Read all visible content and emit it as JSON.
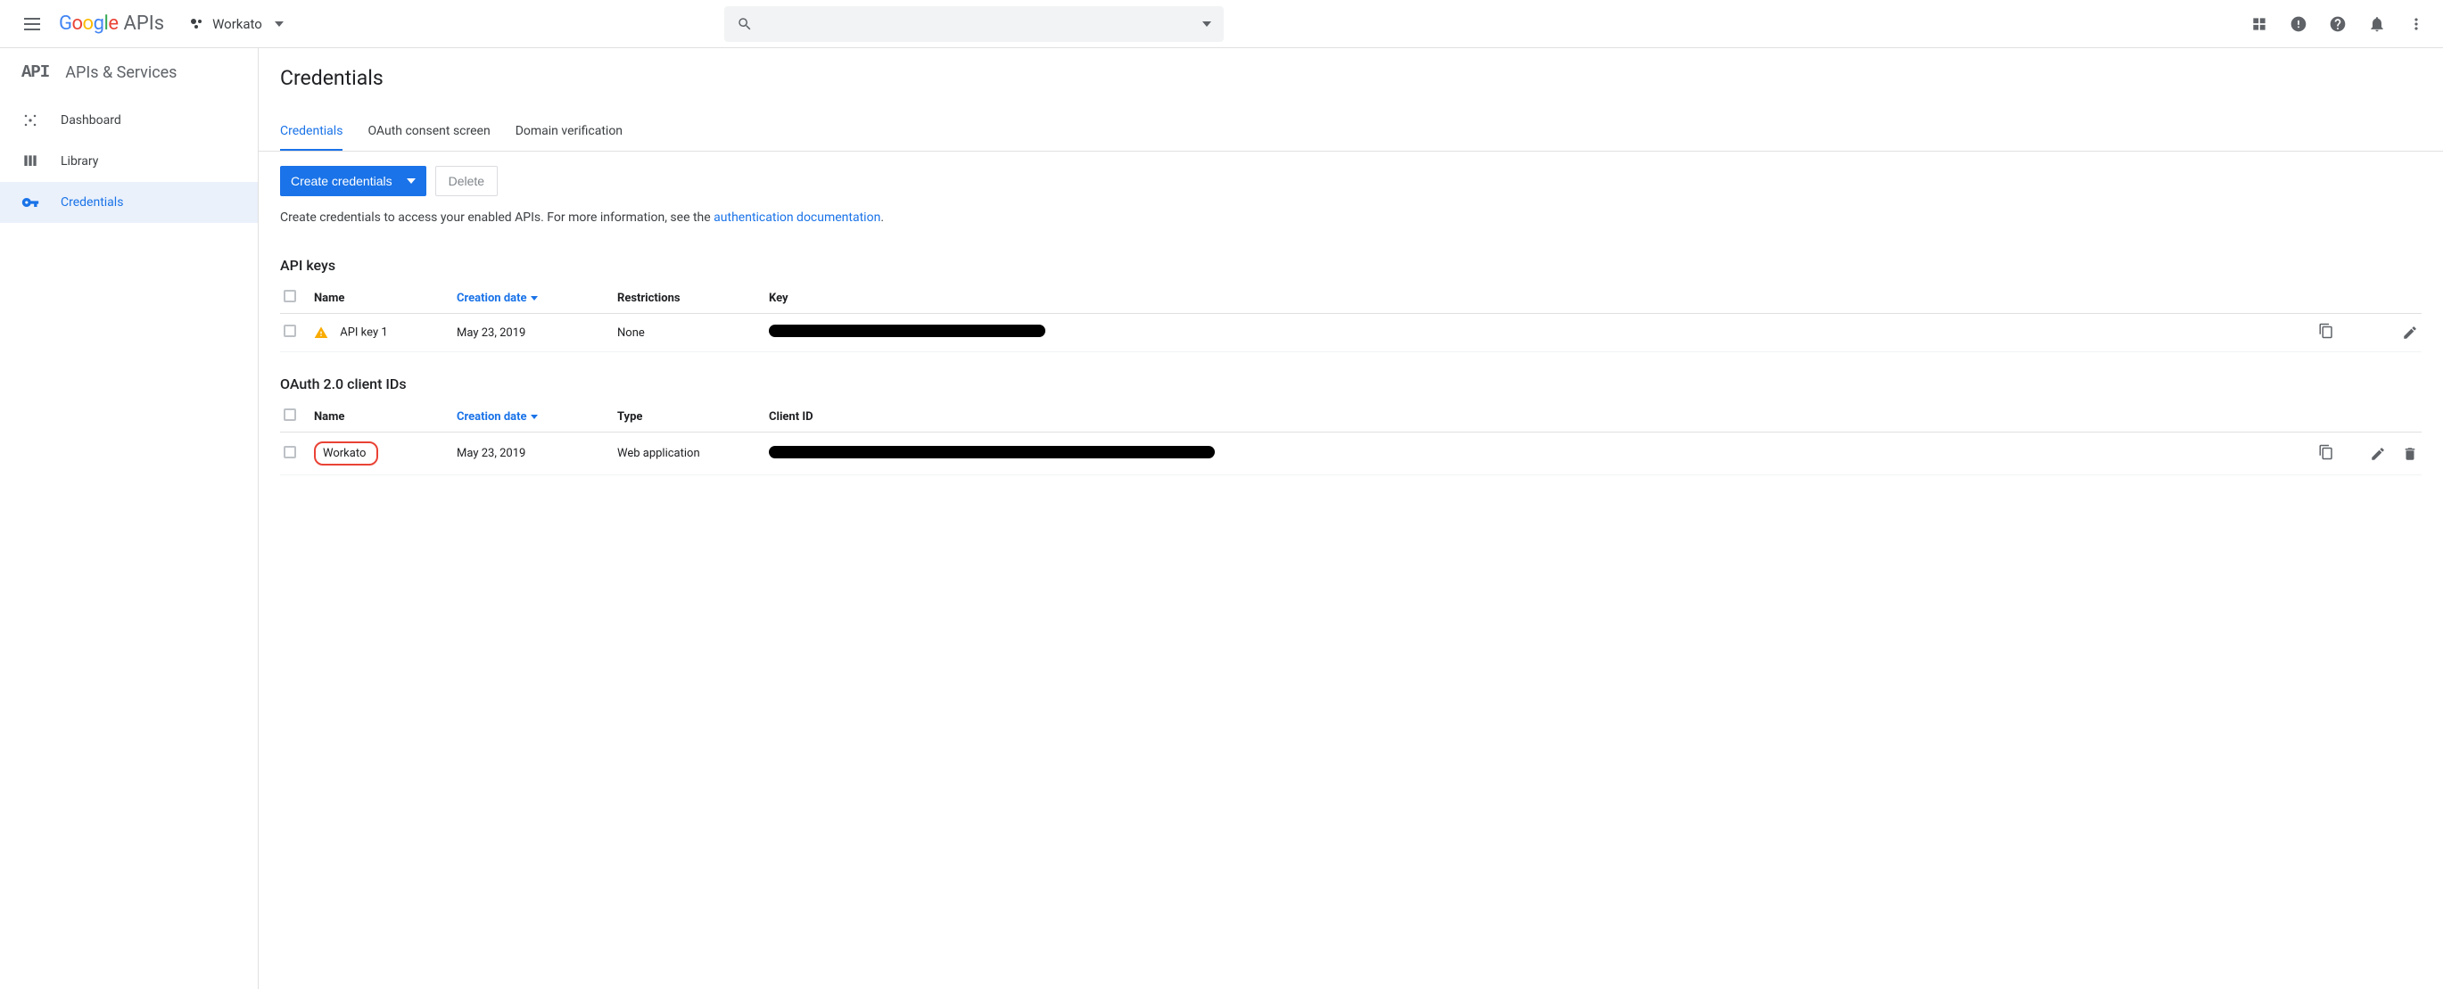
{
  "header": {
    "logo_apis": "APIs",
    "project_name": "Workato"
  },
  "sidebar": {
    "api_badge": "API",
    "title": "APIs & Services",
    "items": [
      {
        "label": "Dashboard"
      },
      {
        "label": "Library"
      },
      {
        "label": "Credentials"
      }
    ]
  },
  "page": {
    "title": "Credentials",
    "tabs": [
      {
        "label": "Credentials"
      },
      {
        "label": "OAuth consent screen"
      },
      {
        "label": "Domain verification"
      }
    ],
    "create_btn": "Create credentials",
    "delete_btn": "Delete",
    "help_prefix": "Create credentials to access your enabled APIs. For more information, see the ",
    "help_link": "authentication documentation",
    "help_suffix": "."
  },
  "apikeys": {
    "heading": "API keys",
    "cols": {
      "name": "Name",
      "date": "Creation date",
      "restrictions": "Restrictions",
      "key": "Key"
    },
    "rows": [
      {
        "name": "API key 1",
        "date": "May 23, 2019",
        "restrictions": "None"
      }
    ]
  },
  "oauth": {
    "heading": "OAuth 2.0 client IDs",
    "cols": {
      "name": "Name",
      "date": "Creation date",
      "type": "Type",
      "client_id": "Client ID"
    },
    "rows": [
      {
        "name": "Workato",
        "date": "May 23, 2019",
        "type": "Web application"
      }
    ]
  }
}
